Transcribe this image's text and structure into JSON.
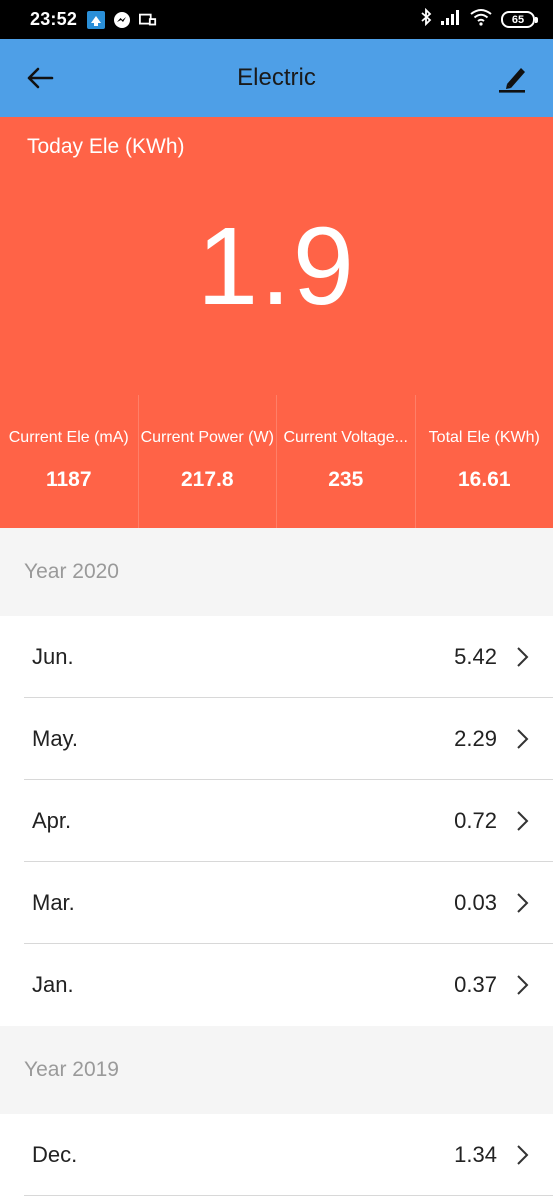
{
  "status_bar": {
    "time": "23:52",
    "battery": "65"
  },
  "app_bar": {
    "title": "Electric"
  },
  "today": {
    "label": "Today Ele (KWh)",
    "value": "1.9"
  },
  "stats": [
    {
      "label": "Current Ele (mA)",
      "value": "1187"
    },
    {
      "label": "Current Power (W)",
      "value": "217.8"
    },
    {
      "label": "Current Voltage...",
      "value": "235"
    },
    {
      "label": "Total Ele (KWh)",
      "value": "16.61"
    }
  ],
  "years": [
    {
      "title": "Year 2020",
      "months": [
        {
          "label": "Jun.",
          "value": "5.42"
        },
        {
          "label": "May.",
          "value": "2.29"
        },
        {
          "label": "Apr.",
          "value": "0.72"
        },
        {
          "label": "Mar.",
          "value": "0.03"
        },
        {
          "label": "Jan.",
          "value": "0.37"
        }
      ]
    },
    {
      "title": "Year 2019",
      "months": [
        {
          "label": "Dec.",
          "value": "1.34"
        }
      ]
    }
  ],
  "colors": {
    "app_bar": "#4e9fe7",
    "hero": "#ff6347",
    "section_header_bg": "#f5f5f5"
  }
}
